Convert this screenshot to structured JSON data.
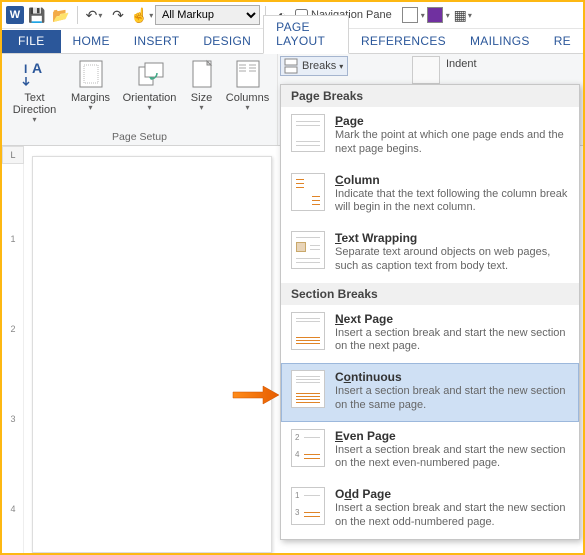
{
  "qat": {
    "markup_value": "All Markup",
    "nav_pane_label": "Navigation Pane",
    "nav_pane_checked": false,
    "purple_swatch": "#7030a0"
  },
  "tabs": {
    "file": "FILE",
    "home": "HOME",
    "insert": "INSERT",
    "design": "DESIGN",
    "page_layout": "PAGE LAYOUT",
    "references": "REFERENCES",
    "mailings": "MAILINGS",
    "review_partial": "RE"
  },
  "ribbon": {
    "text_direction": "Text Direction",
    "margins": "Margins",
    "orientation": "Orientation",
    "size": "Size",
    "columns": "Columns",
    "group_page_setup": "Page Setup",
    "breaks": "Breaks",
    "indent": "Indent"
  },
  "ruler": {
    "corner": "L",
    "marks": [
      "1",
      "2",
      "3",
      "4"
    ]
  },
  "breaks_menu": {
    "section_page_breaks": "Page Breaks",
    "section_section_breaks": "Section Breaks",
    "highlighted_index": 4,
    "items": [
      {
        "title": "Page",
        "underline": "P",
        "desc": "Mark the point at which one page ends and the next page begins."
      },
      {
        "title": "Column",
        "underline": "C",
        "desc": "Indicate that the text following the column break will begin in the next column."
      },
      {
        "title": "Text Wrapping",
        "underline": "T",
        "desc": "Separate text around objects on web pages, such as caption text from body text."
      },
      {
        "title": "Next Page",
        "underline": "N",
        "desc": "Insert a section break and start the new section on the next page."
      },
      {
        "title": "Continuous",
        "underline": "o",
        "desc": "Insert a section break and start the new section on the same page."
      },
      {
        "title": "Even Page",
        "underline": "E",
        "desc": "Insert a section break and start the new section on the next even-numbered page."
      },
      {
        "title": "Odd Page",
        "underline": "d",
        "desc": "Insert a section break and start the new section on the next odd-numbered page."
      }
    ]
  }
}
